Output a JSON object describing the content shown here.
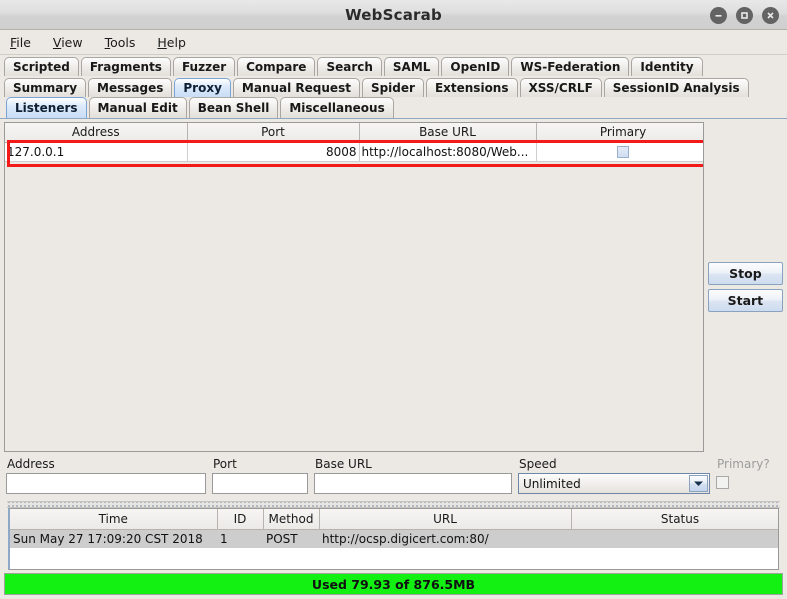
{
  "window": {
    "title": "WebScarab",
    "controls": [
      {
        "name": "minimize",
        "glyph": "minimize-icon"
      },
      {
        "name": "maximize",
        "glyph": "maximize-icon"
      },
      {
        "name": "close",
        "glyph": "close-icon"
      }
    ]
  },
  "menubar": {
    "items": [
      {
        "mnemonic": "F",
        "rest": "ile"
      },
      {
        "mnemonic": "V",
        "rest": "iew"
      },
      {
        "mnemonic": "T",
        "rest": "ools"
      },
      {
        "mnemonic": "H",
        "rest": "elp"
      }
    ]
  },
  "tabs_row1": [
    {
      "label": "Scripted",
      "selected": false
    },
    {
      "label": "Fragments",
      "selected": false
    },
    {
      "label": "Fuzzer",
      "selected": false
    },
    {
      "label": "Compare",
      "selected": false
    },
    {
      "label": "Search",
      "selected": false
    },
    {
      "label": "SAML",
      "selected": false
    },
    {
      "label": "OpenID",
      "selected": false
    },
    {
      "label": "WS-Federation",
      "selected": false
    },
    {
      "label": "Identity",
      "selected": false
    }
  ],
  "tabs_row2": [
    {
      "label": "Summary",
      "selected": false
    },
    {
      "label": "Messages",
      "selected": false
    },
    {
      "label": "Proxy",
      "selected": true
    },
    {
      "label": "Manual Request",
      "selected": false
    },
    {
      "label": "Spider",
      "selected": false
    },
    {
      "label": "Extensions",
      "selected": false
    },
    {
      "label": "XSS/CRLF",
      "selected": false
    },
    {
      "label": "SessionID Analysis",
      "selected": false
    }
  ],
  "tabs_row3": [
    {
      "label": "Listeners",
      "selected": true
    },
    {
      "label": "Manual Edit",
      "selected": false
    },
    {
      "label": "Bean Shell",
      "selected": false
    },
    {
      "label": "Miscellaneous",
      "selected": false
    }
  ],
  "listeners_table": {
    "columns": [
      "Address",
      "Port",
      "Base URL",
      "Primary"
    ],
    "rows": [
      {
        "address": "127.0.0.1",
        "port": "8008",
        "base_url": "http://localhost:8080/Web...",
        "primary_checked": false
      }
    ],
    "highlight_color": "#f31a1a"
  },
  "side_buttons": [
    {
      "label": "Stop"
    },
    {
      "label": "Start"
    }
  ],
  "new_listener_form": {
    "address": {
      "label": "Address",
      "value": "",
      "placeholder": ""
    },
    "port": {
      "label": "Port",
      "value": "",
      "placeholder": ""
    },
    "base_url": {
      "label": "Base URL",
      "value": "",
      "placeholder": ""
    },
    "speed": {
      "label": "Speed",
      "value": "Unlimited",
      "options": [
        "Unlimited"
      ]
    },
    "primary": {
      "label": "Primary?",
      "checked": false,
      "disabled": true
    }
  },
  "log_table": {
    "columns": [
      "Time",
      "ID",
      "Method",
      "URL",
      "Status"
    ],
    "rows": [
      {
        "time": "Sun May 27 17:09:20 CST 2018",
        "id": "1",
        "method": "POST",
        "url": "http://ocsp.digicert.com:80/",
        "status": "",
        "selected": true
      }
    ]
  },
  "statusbar": {
    "text": "Used 79.93 of 876.5MB",
    "color": "#13f113"
  }
}
